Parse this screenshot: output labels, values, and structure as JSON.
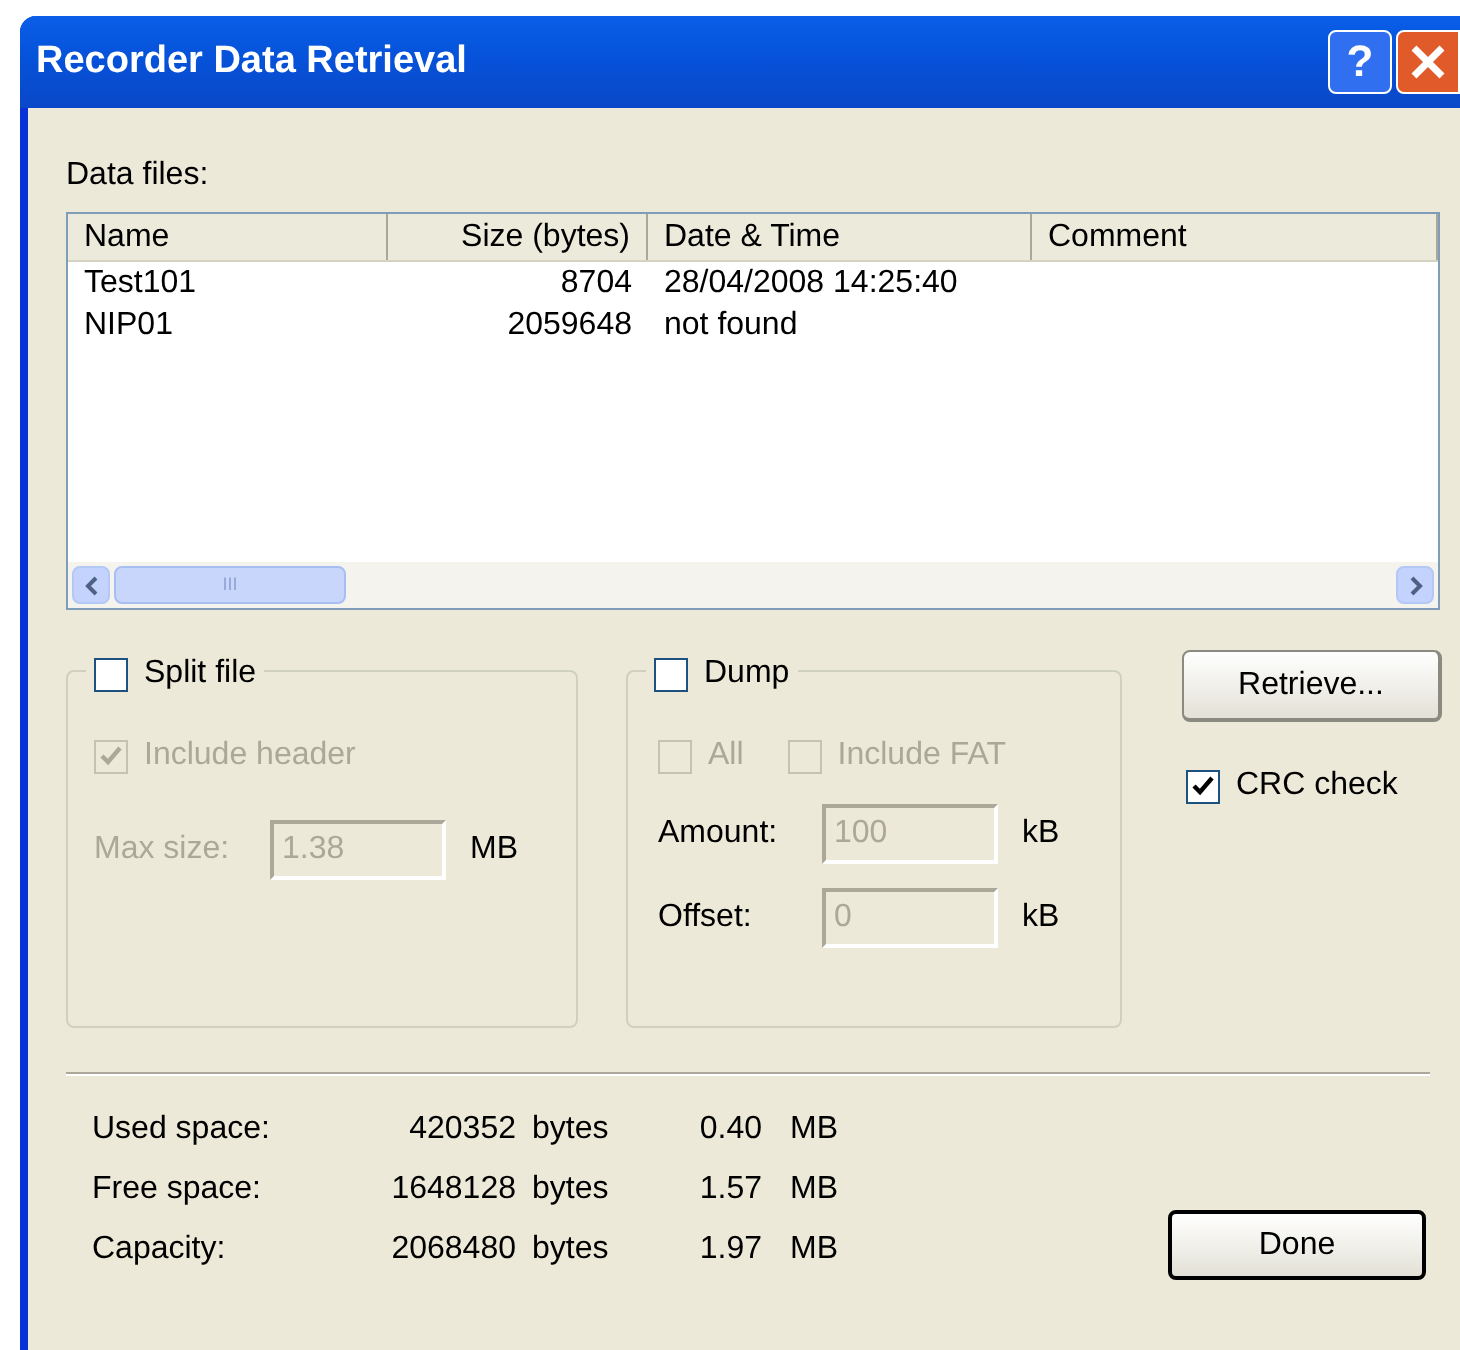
{
  "window": {
    "title": "Recorder Data Retrieval",
    "help_button": "?"
  },
  "data_files_label": "Data files:",
  "table": {
    "columns": [
      "Name",
      "Size (bytes)",
      "Date & Time",
      "Comment"
    ],
    "rows": [
      {
        "name": "Test101",
        "size": "8704",
        "date_time": "28/04/2008 14:25:40"
      },
      {
        "name": "NIP01",
        "size": "2059648",
        "date_time": "not found"
      }
    ],
    "scrollbar_grip": "III"
  },
  "split_file": {
    "label": "Split file",
    "checked": false,
    "include_header": {
      "label": "Include header",
      "checked": true,
      "disabled": true
    },
    "max_size": {
      "label": "Max size:",
      "value": "1.38",
      "unit": "MB",
      "disabled": true
    }
  },
  "dump": {
    "label": "Dump",
    "checked": false,
    "options": [
      {
        "label": "All",
        "checked": false,
        "disabled": true
      },
      {
        "label": "Include FAT",
        "checked": false,
        "disabled": true
      }
    ],
    "fields": [
      {
        "label": "Amount:",
        "value": "100",
        "unit": "kB",
        "disabled": true
      },
      {
        "label": "Offset:",
        "value": "0",
        "unit": "kB",
        "disabled": true
      }
    ]
  },
  "retrieve_button": "Retrieve...",
  "crc_check": {
    "label": "CRC check",
    "checked": true
  },
  "stats": [
    {
      "label": "Used space:",
      "bytes": "420352",
      "bytes_unit": "bytes",
      "mb": "0.40",
      "mb_unit": "MB"
    },
    {
      "label": "Free space:",
      "bytes": "1648128",
      "bytes_unit": "bytes",
      "mb": "1.57",
      "mb_unit": "MB"
    },
    {
      "label": "Capacity:",
      "bytes": "2068480",
      "bytes_unit": "bytes",
      "mb": "1.97",
      "mb_unit": "MB"
    }
  ],
  "done_button": "Done"
}
